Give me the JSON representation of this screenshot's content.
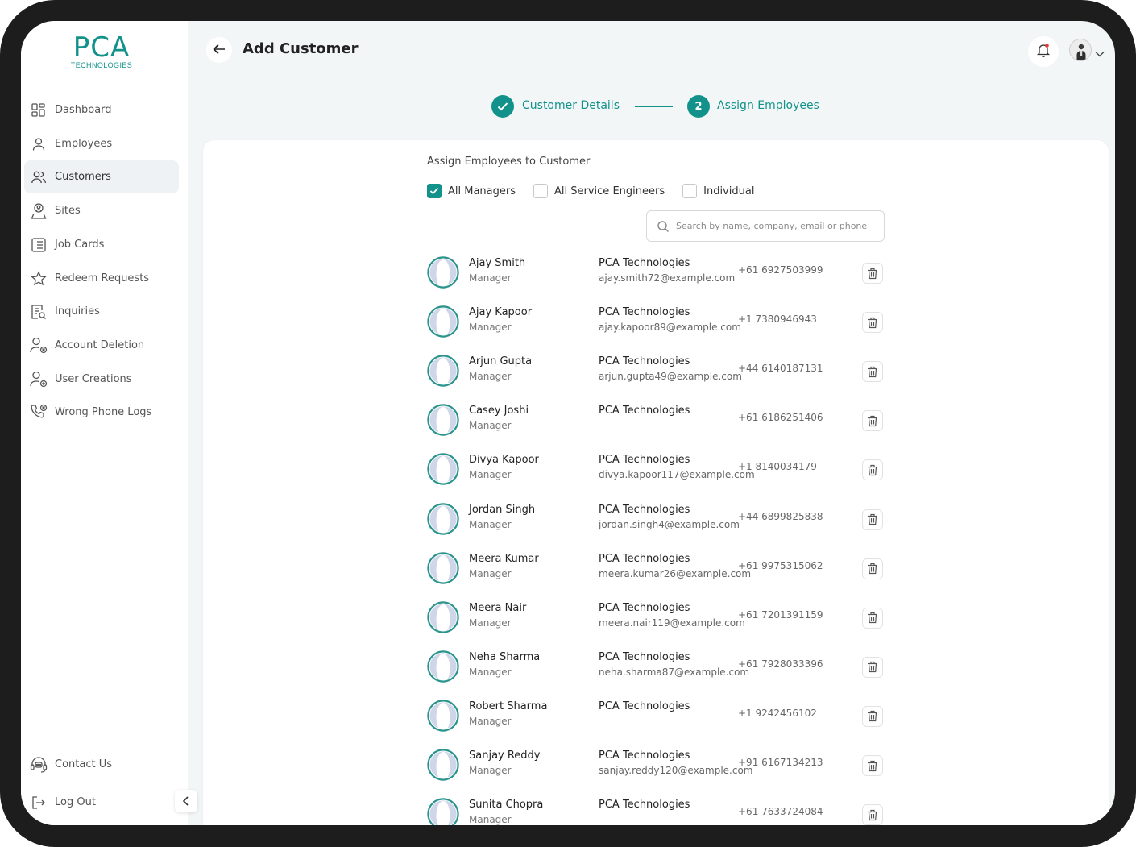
{
  "brand": {
    "logo_main": "PCA",
    "logo_sub": "TECHNOLOGIES",
    "accent": "#12928a"
  },
  "sidebar": {
    "items": [
      {
        "label": "Dashboard",
        "icon": "grid-icon"
      },
      {
        "label": "Employees",
        "icon": "user-icon"
      },
      {
        "label": "Customers",
        "icon": "users-icon",
        "active": true
      },
      {
        "label": "Sites",
        "icon": "location-user-icon"
      },
      {
        "label": "Job Cards",
        "icon": "list-card-icon"
      },
      {
        "label": "Redeem Requests",
        "icon": "star-icon"
      },
      {
        "label": "Inquiries",
        "icon": "document-search-icon"
      },
      {
        "label": "Account Deletion",
        "icon": "user-remove-icon"
      },
      {
        "label": "User Creations",
        "icon": "user-add-icon"
      },
      {
        "label": "Wrong Phone Logs",
        "icon": "phone-x-icon"
      }
    ],
    "bottom": [
      {
        "label": "Contact Us",
        "icon": "headset-icon"
      },
      {
        "label": "Log Out",
        "icon": "logout-icon"
      }
    ]
  },
  "header": {
    "title": "Add Customer"
  },
  "stepper": {
    "step1": {
      "label": "Customer Details",
      "state": "done"
    },
    "step2": {
      "number": "2",
      "label": "Assign Employees",
      "state": "active"
    }
  },
  "assign": {
    "title": "Assign Employees to Customer",
    "options": [
      {
        "label": "All Managers",
        "checked": true
      },
      {
        "label": "All Service Engineers",
        "checked": false
      },
      {
        "label": "Individual",
        "checked": false
      }
    ],
    "search_placeholder": "Search by name, company, email or phone"
  },
  "employees": [
    {
      "name": "Ajay Smith",
      "role": "Manager",
      "company": "PCA Technologies",
      "email": "ajay.smith72@example.com",
      "phone": "+61 6927503999"
    },
    {
      "name": "Ajay Kapoor",
      "role": "Manager",
      "company": "PCA Technologies",
      "email": "ajay.kapoor89@example.com",
      "phone": "+1 7380946943"
    },
    {
      "name": "Arjun Gupta",
      "role": "Manager",
      "company": "PCA Technologies",
      "email": "arjun.gupta49@example.com",
      "phone": "+44 6140187131"
    },
    {
      "name": "Casey Joshi",
      "role": "Manager",
      "company": "PCA Technologies",
      "email": "",
      "phone": "+61 6186251406"
    },
    {
      "name": "Divya Kapoor",
      "role": "Manager",
      "company": "PCA Technologies",
      "email": "divya.kapoor117@example.com",
      "phone": "+1 8140034179"
    },
    {
      "name": "Jordan Singh",
      "role": "Manager",
      "company": "PCA Technologies",
      "email": "jordan.singh4@example.com",
      "phone": "+44 6899825838"
    },
    {
      "name": "Meera Kumar",
      "role": "Manager",
      "company": "PCA Technologies",
      "email": "meera.kumar26@example.com",
      "phone": "+61 9975315062"
    },
    {
      "name": "Meera Nair",
      "role": "Manager",
      "company": "PCA Technologies",
      "email": "meera.nair119@example.com",
      "phone": "+61 7201391159"
    },
    {
      "name": "Neha Sharma",
      "role": "Manager",
      "company": "PCA Technologies",
      "email": "neha.sharma87@example.com",
      "phone": "+61 7928033396"
    },
    {
      "name": "Robert Sharma",
      "role": "Manager",
      "company": "PCA Technologies",
      "email": "",
      "phone": "+1 9242456102"
    },
    {
      "name": "Sanjay Reddy",
      "role": "Manager",
      "company": "PCA Technologies",
      "email": "sanjay.reddy120@example.com",
      "phone": "+91 6167134213"
    },
    {
      "name": "Sunita Chopra",
      "role": "Manager",
      "company": "PCA Technologies",
      "email": "",
      "phone": "+61 7633724084"
    }
  ]
}
